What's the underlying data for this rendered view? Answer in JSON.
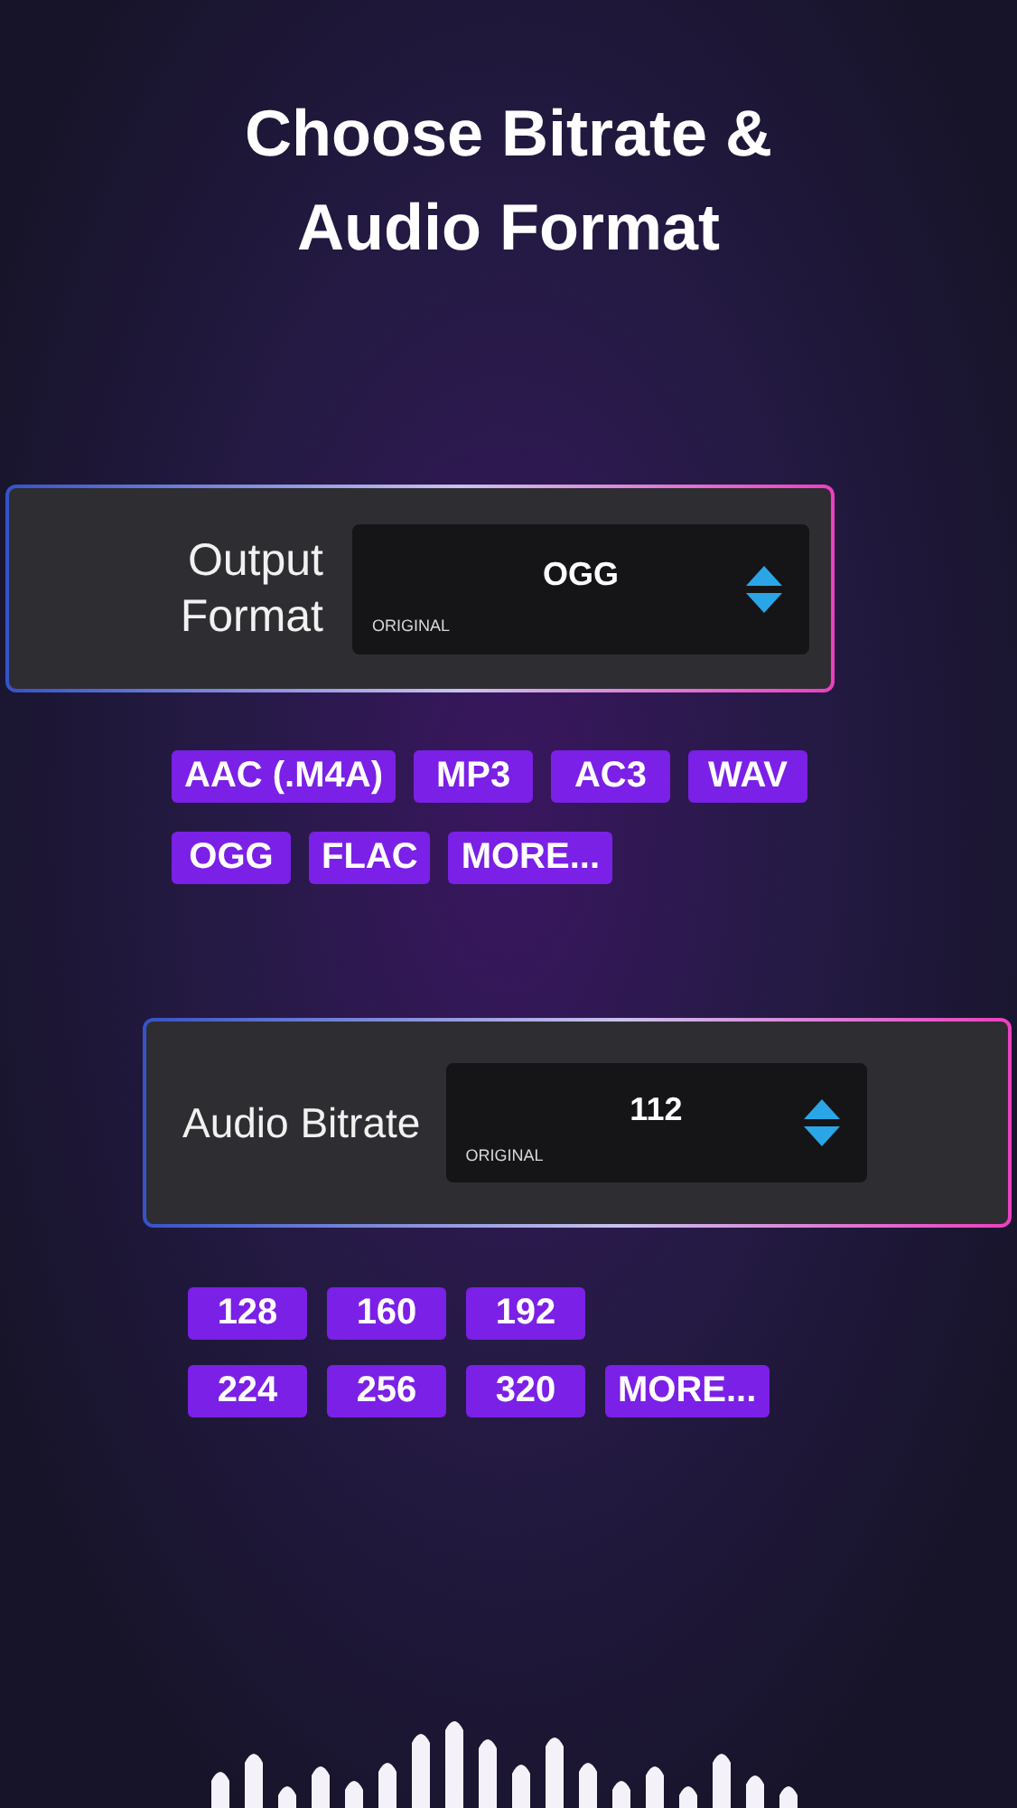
{
  "title": "Choose Bitrate & Audio Format",
  "selectors": [
    {
      "label": "Output Format",
      "value": "OGG",
      "caption": "ORIGINAL",
      "options": [
        [
          "AAC (.M4A)",
          "MP3",
          "AC3",
          "WAV"
        ],
        [
          "OGG",
          "FLAC",
          "MORE..."
        ]
      ]
    },
    {
      "label": "Audio Bitrate",
      "value": "112",
      "caption": "ORIGINAL",
      "options": [
        [
          "128",
          "160",
          "192"
        ],
        [
          "224",
          "256",
          "320",
          "MORE..."
        ]
      ]
    }
  ]
}
